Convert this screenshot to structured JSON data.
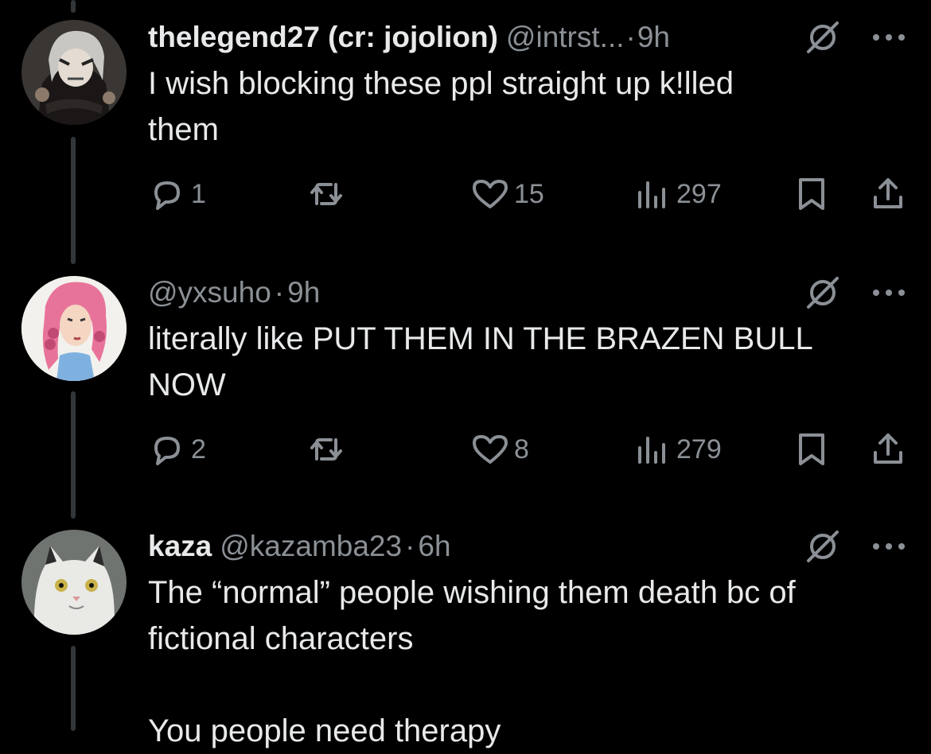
{
  "thread": {
    "tweets": [
      {
        "display_name": "thelegend27 (cr: jojolion)",
        "handle": "@intrst...",
        "dot": "·",
        "time": "9h",
        "text": "I wish blocking these ppl straight up k!lled\nthem",
        "replies": "1",
        "likes": "15",
        "views": "297"
      },
      {
        "display_name": "",
        "handle": "@yxsuho",
        "dot": "·",
        "time": "9h",
        "text": "literally like PUT THEM IN THE BRAZEN BULL\nNOW",
        "replies": "2",
        "likes": "8",
        "views": "279"
      },
      {
        "display_name": "kaza",
        "handle": "@kazamba23",
        "dot": "·",
        "time": "6h",
        "text": "The “normal” people wishing them death bc of\nfictional characters\n\nYou people need therapy"
      }
    ]
  },
  "icons": {
    "reply": "reply-icon",
    "retweet": "retweet-icon",
    "like": "heart-icon",
    "views": "views-icon",
    "bookmark": "bookmark-icon",
    "share": "share-icon",
    "grok": "grok-icon",
    "more": "more-icon"
  },
  "colors": {
    "background": "#000000",
    "text": "#e7e9ea",
    "secondary": "#8b9096",
    "thread_line": "#333639"
  }
}
